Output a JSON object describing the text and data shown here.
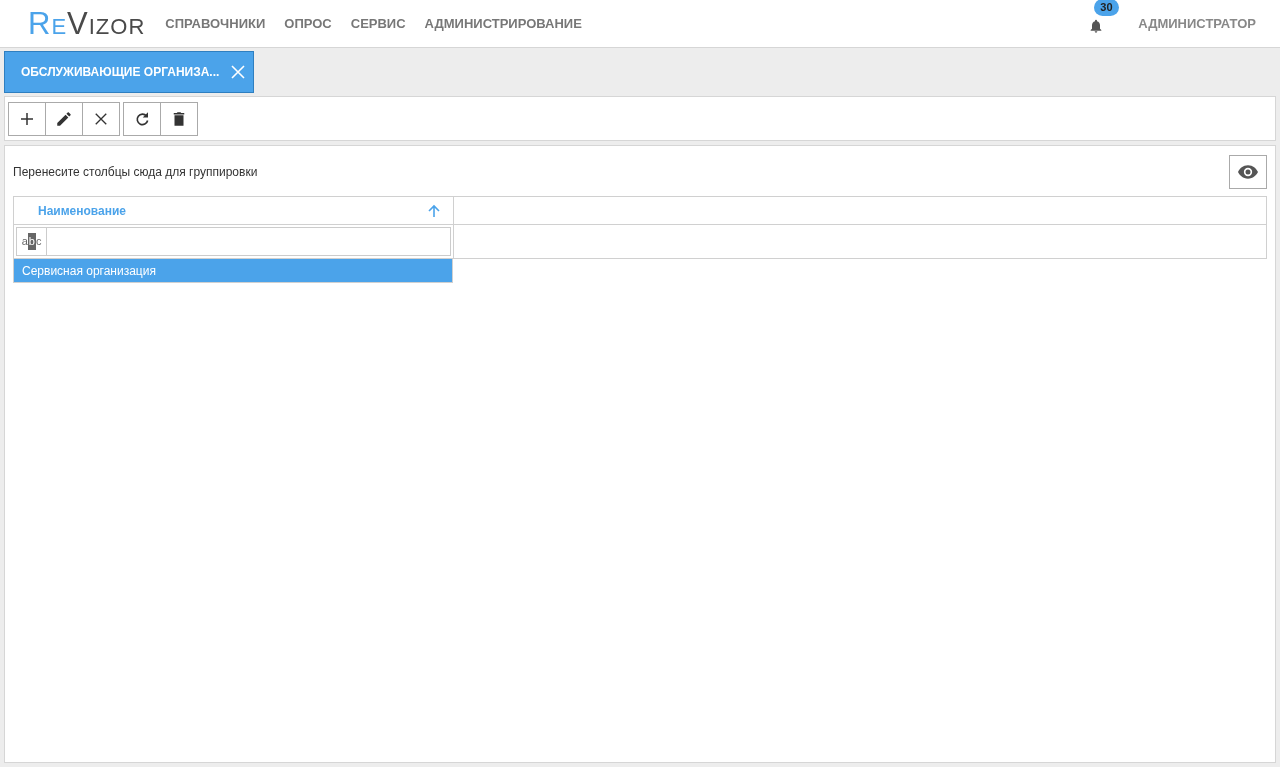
{
  "logo": {
    "accent": "Re",
    "rest": "Vizor"
  },
  "menu": [
    "СПРАВОЧНИКИ",
    "ОПРОС",
    "СЕРВИС",
    "АДМИНИСТРИРОВАНИЕ"
  ],
  "notifications": {
    "count": "30"
  },
  "user": "АДМИНИСТРАТОР",
  "tabs": [
    {
      "label": "ОБСЛУЖИВАЮЩИЕ ОРГАНИЗА...",
      "selected": true
    }
  ],
  "toolbar": [
    {
      "kind": "add"
    },
    {
      "kind": "edit"
    },
    {
      "kind": "cancel"
    },
    {
      "kind": "refresh"
    },
    {
      "kind": "delete"
    }
  ],
  "group_hint": "Перенесите столбцы сюда для группировки",
  "table": {
    "columns": [
      {
        "label": "Наименование",
        "sorted_ascending": true
      }
    ],
    "filter": {
      "type_label": "abc"
    },
    "rows": [
      {
        "cells": [
          "Сервисная организация"
        ],
        "selected": true
      }
    ]
  }
}
